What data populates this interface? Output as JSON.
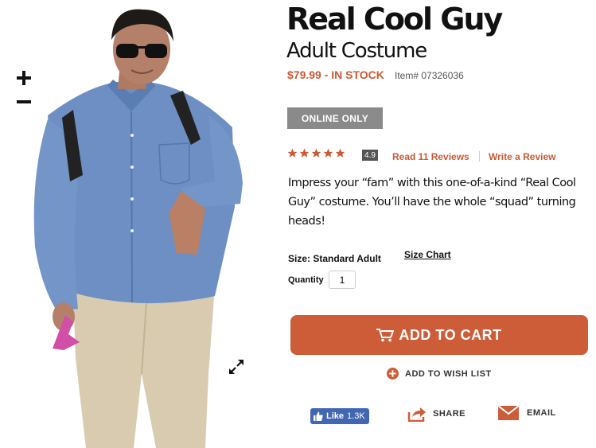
{
  "product": {
    "title": "Real Cool Guy",
    "subtitle": "Adult Costume",
    "price_status": "$79.99 - IN STOCK",
    "item_number": "Item# 07326036",
    "badge": "ONLINE ONLY",
    "rating": 4.9,
    "rating_label": "4.9",
    "stars": 5,
    "read_reviews": "Read 11 Reviews",
    "write_review": "Write a Review",
    "description": "Impress your “fam” with this one-of-a-kind “Real Cool Guy” costume. You’ll have the whole “squad” turning heads!",
    "size_label": "Size: Standard Adult",
    "size_chart": "Size Chart",
    "quantity_label": "Quantity",
    "quantity_value": "1"
  },
  "actions": {
    "add_to_cart": "ADD TO CART",
    "add_to_wish_list": "ADD TO WISH LIST"
  },
  "social": {
    "like_label": "Like",
    "like_count": "1.3K",
    "share": "SHARE",
    "email": "EMAIL"
  },
  "icons": {
    "zoom_in": "plus-icon",
    "zoom_out": "minus-icon",
    "expand": "expand-icon",
    "cart": "cart-icon",
    "wish": "plus-circle-icon",
    "share": "share-arrow-icon",
    "email": "envelope-icon",
    "star": "star-icon"
  },
  "colors": {
    "accent": "#cd5d39",
    "badge": "#8a8a8a",
    "facebook": "#4267b2"
  }
}
